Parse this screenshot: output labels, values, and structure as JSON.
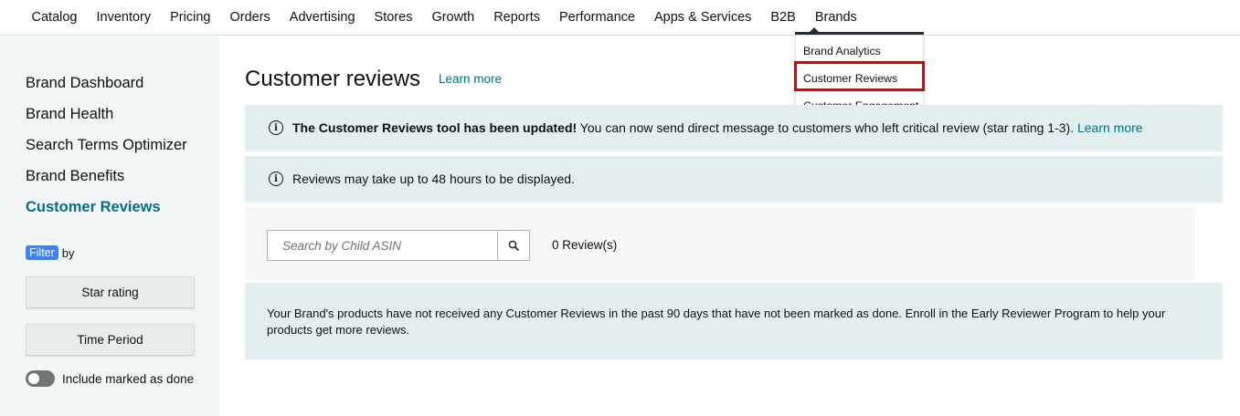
{
  "nav": {
    "items": [
      "Catalog",
      "Inventory",
      "Pricing",
      "Orders",
      "Advertising",
      "Stores",
      "Growth",
      "Reports",
      "Performance",
      "Apps & Services",
      "B2B",
      "Brands"
    ]
  },
  "brands_menu": {
    "items": [
      "Brand Analytics",
      "Customer Reviews",
      "Customer Engagement"
    ],
    "highlighted": "Customer Reviews",
    "highlight_color": "#e60000"
  },
  "sidebar": {
    "links": [
      "Brand Dashboard",
      "Brand Health",
      "Search Terms Optimizer",
      "Brand Benefits",
      "Customer Reviews"
    ],
    "active": "Customer Reviews",
    "filter_chip": "Filter",
    "filter_suffix": "by",
    "star_rating_label": "Star rating",
    "time_period_label": "Time Period",
    "include_done_label": "Include marked as done",
    "include_done_on": false
  },
  "main": {
    "title": "Customer reviews",
    "learn_more": "Learn more",
    "update_alert": {
      "bold": "The Customer Reviews tool has been updated!",
      "text": " You can now send direct message to customers who left critical review (star rating 1-3). ",
      "link": "Learn more"
    },
    "delay_alert": "Reviews may take up to 48 hours to be displayed.",
    "search": {
      "placeholder": "Search by Child ASIN",
      "value": ""
    },
    "review_count": "0 Review(s)",
    "empty_message": "Your Brand's products have not received any Customer Reviews in the past 90 days that have not been marked as done. Enroll in the Early Reviewer Program to help your products get more reviews."
  },
  "colors": {
    "link": "#007185",
    "alert_bg": "#e2efee",
    "sidebar_bg": "#f3f6f6",
    "filter_chip": "#3b82f6"
  }
}
